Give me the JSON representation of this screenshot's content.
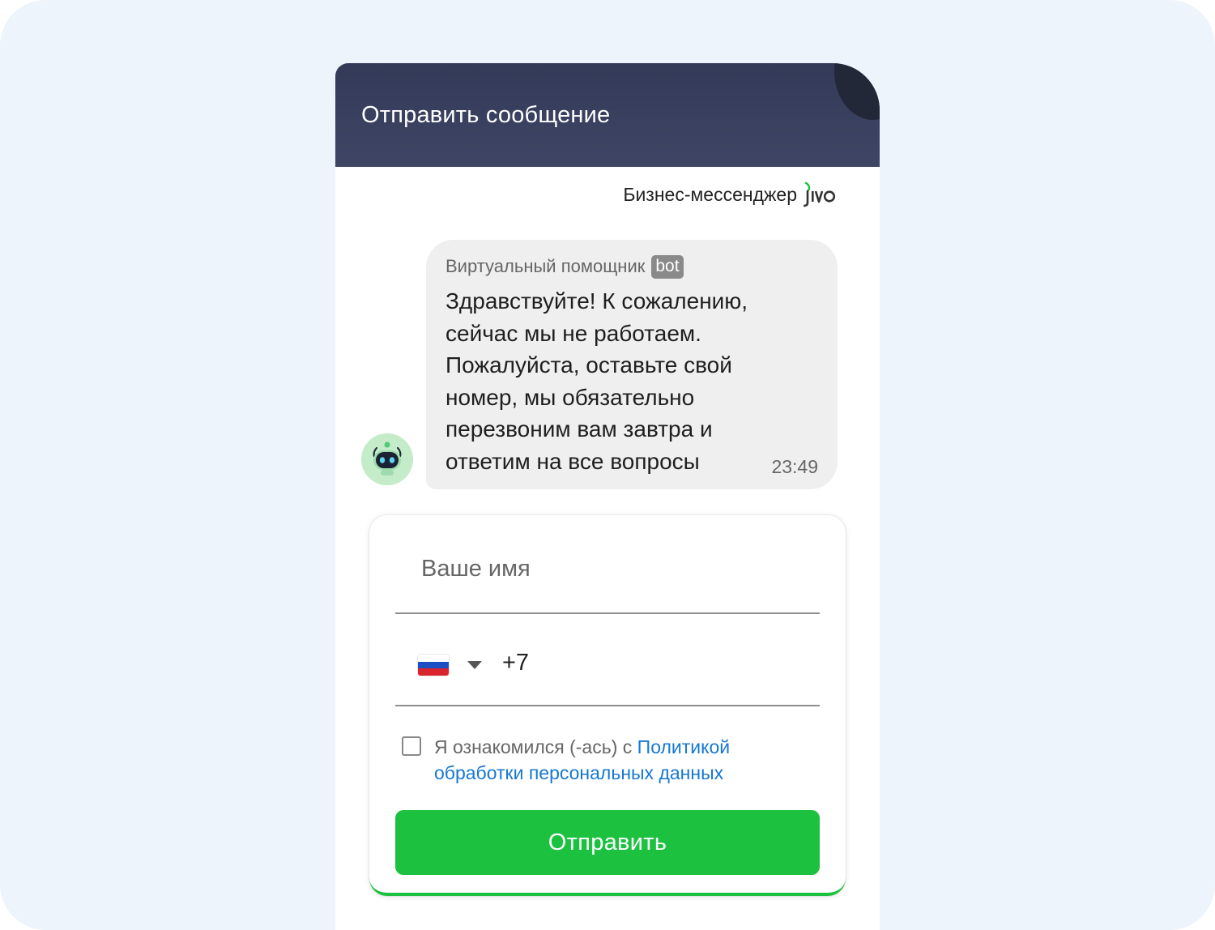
{
  "header": {
    "title": "Отправить сообщение"
  },
  "brand": {
    "text": "Бизнес-мессенджер",
    "logo_text": "jivo"
  },
  "message": {
    "sender": "Виртуальный помощник",
    "badge": "bot",
    "text": "Здравствуйте! К сожалению, сейчас мы не работаем. Пожалуйста, оставьте свой номер, мы обязательно перезвоним вам завтра и ответим на все вопросы",
    "time": "23:49",
    "avatar_icon": "robot-avatar-icon"
  },
  "form": {
    "name_placeholder": "Ваше имя",
    "name_value": "",
    "phone_code": "+7",
    "country_icon": "russia-flag-icon",
    "consent_text": "Я ознакомился (-ась) с",
    "consent_link": "Политикой обработки персональных данных",
    "consent_checked": false,
    "submit_label": "Отправить"
  },
  "colors": {
    "header_bg": "#363d5c",
    "accent_green": "#1cc13f",
    "link_blue": "#1678d2",
    "bubble_bg": "#efefef",
    "page_bg": "#eef4fc"
  }
}
